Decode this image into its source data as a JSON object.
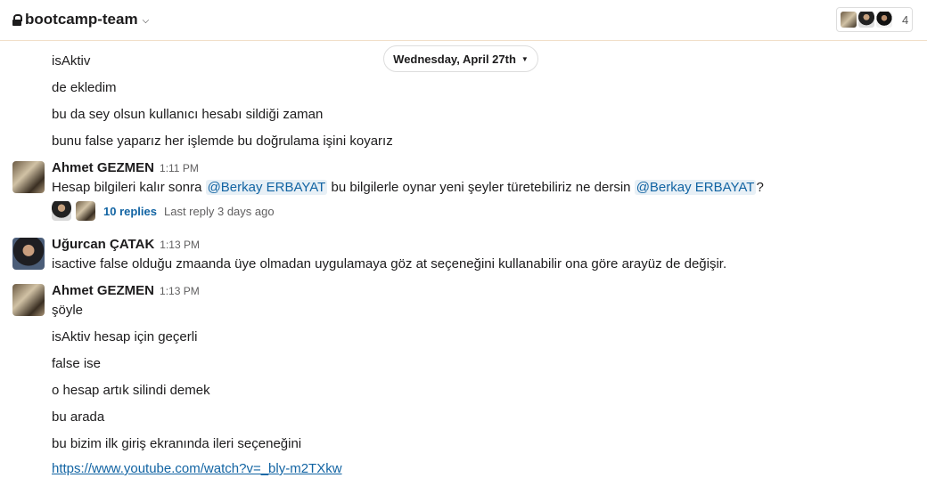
{
  "header": {
    "channel_name": "bootcamp-team",
    "member_count": "4"
  },
  "date_divider": "Wednesday, April 27th",
  "messages": [
    {
      "text": "isAktiv"
    },
    {
      "text": "de ekledim"
    },
    {
      "text": "bu da sey olsun kullanıcı hesabı sildiği zaman"
    },
    {
      "text": "bunu false yaparız her işlemde bu doğrulama işini koyarız"
    },
    {
      "sender": "Ahmet GEZMEN",
      "time": "1:11 PM",
      "parts": [
        "Hesap bilgileri kalır sonra ",
        "@Berkay ERBAYAT",
        " bu bilgilerle oynar yeni şeyler türetebiliriz ne dersin ",
        "@Berkay ERBAYAT",
        "?"
      ],
      "replies": {
        "count": "10 replies",
        "last": "Last reply 3 days ago"
      }
    },
    {
      "sender": "Uğurcan ÇATAK",
      "time": "1:13 PM",
      "text": "isactive false olduğu zmaanda üye olmadan uygulamaya göz at seçeneğini kullanabilir ona göre arayüz de değişir."
    },
    {
      "sender": "Ahmet GEZMEN",
      "time": "1:13 PM",
      "text": "şöyle"
    },
    {
      "text": "isAktiv hesap için geçerli"
    },
    {
      "text": "false ise"
    },
    {
      "text": "o hesap artık silindi demek"
    },
    {
      "text": "bu arada"
    },
    {
      "text": "bu bizim ilk giriş ekranında ileri seçeneğini"
    },
    {
      "link": "https://www.youtube.com/watch?v=_bly-m2TXkw"
    }
  ]
}
